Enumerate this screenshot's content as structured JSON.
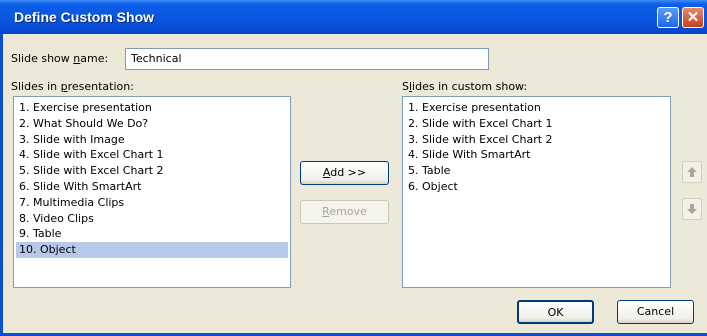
{
  "window": {
    "title": "Define Custom Show",
    "help_label": "?",
    "close_label": "✕"
  },
  "name_field": {
    "label_before": "Slide show ",
    "label_accel": "n",
    "label_after": "ame:",
    "value": "Technical"
  },
  "left_list": {
    "label_before": "Slides in ",
    "label_accel": "p",
    "label_after": "resentation:",
    "items": [
      "1. Exercise presentation",
      "2. What Should We Do?",
      "3. Slide with Image",
      "4. Slide with Excel Chart 1",
      "5. Slide with Excel Chart 2",
      "6. Slide With SmartArt",
      "7. Multimedia Clips",
      "8. Video Clips",
      "9. Table",
      "10. Object"
    ],
    "selected": "10. Object"
  },
  "right_list": {
    "label_before": "S",
    "label_accel": "l",
    "label_after": "ides in custom show:",
    "items": [
      "1. Exercise presentation",
      "2. Slide with Excel Chart 1",
      "3. Slide with Excel Chart 2",
      "4. Slide With SmartArt",
      "5. Table",
      "6. Object"
    ]
  },
  "buttons": {
    "add_accel": "A",
    "add_rest": "dd >>",
    "remove_accel": "R",
    "remove_rest": "emove",
    "ok": "OK",
    "cancel": "Cancel"
  },
  "icons": {
    "move_up": "up-arrow-icon",
    "move_down": "down-arrow-icon"
  },
  "colors": {
    "titlebar": "#0854e0",
    "dialog_bg": "#ece9d8",
    "selection": "#b7c9ea"
  }
}
